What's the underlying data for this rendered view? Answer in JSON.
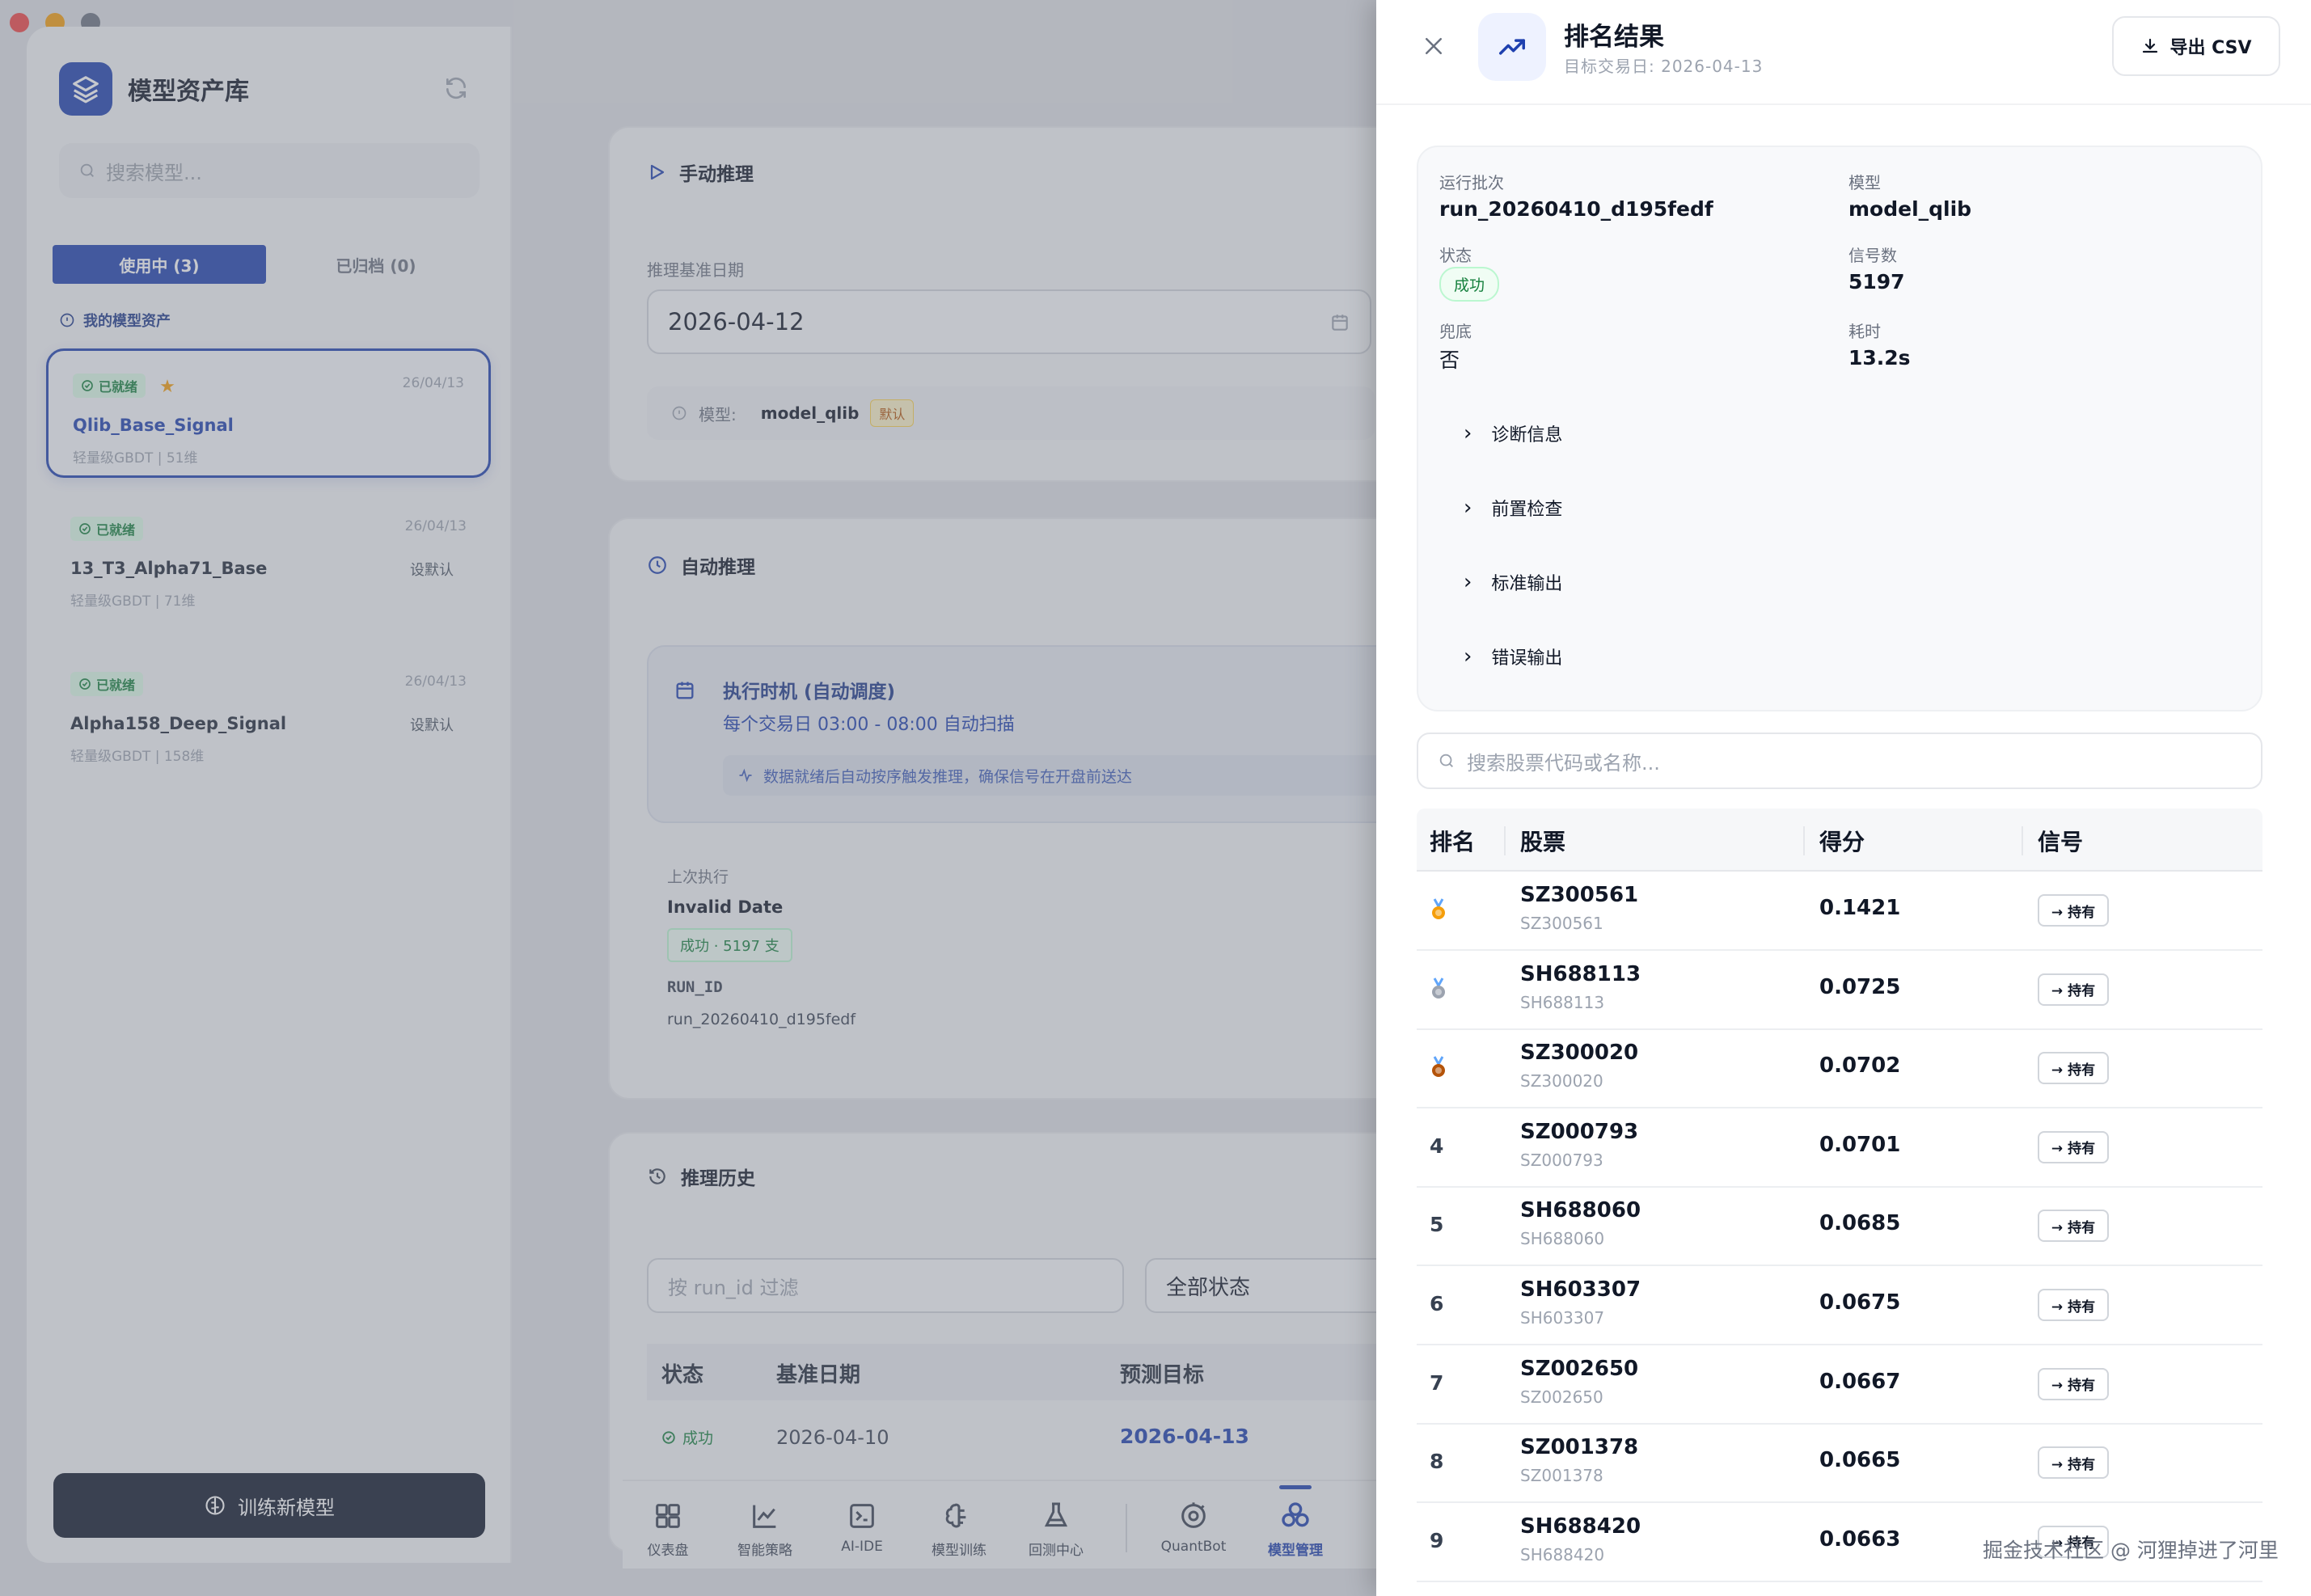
{
  "left": {
    "title": "模型资产库",
    "search_placeholder": "搜索模型...",
    "tab_active": "使用中 (3)",
    "tab_archived": "已归档 (0)",
    "section": "我的模型资产",
    "models": [
      {
        "status": "已就绪",
        "date": "26/04/13",
        "name": "Qlib_Base_Signal",
        "meta": "轻量级GBDT | 51维",
        "starred": true,
        "action": ""
      },
      {
        "status": "已就绪",
        "date": "26/04/13",
        "name": "13_T3_Alpha71_Base",
        "meta": "轻量级GBDT | 71维",
        "starred": false,
        "action": "设默认"
      },
      {
        "status": "已就绪",
        "date": "26/04/13",
        "name": "Alpha158_Deep_Signal",
        "meta": "轻量级GBDT | 158维",
        "starred": false,
        "action": "设默认"
      }
    ],
    "train_button": "训练新模型"
  },
  "middle": {
    "manual_title": "手动推理",
    "base_date_label": "推理基准日期",
    "base_date_value": "2026-04-12",
    "model_label": "模型:",
    "model_value": "model_qlib",
    "default_tag": "默认",
    "auto_title": "自动推理",
    "schedule_title": "执行时机 (自动调度)",
    "schedule_desc": "每个交易日 03:00 - 08:00 自动扫描",
    "schedule_note": "数据就绪后自动按序触发推理，确保信号在开盘前送达",
    "last_exec_label": "上次执行",
    "last_exec_value": "Invalid Date",
    "last_exec_badge": "成功 · 5197 支",
    "run_id_label": "RUN_ID",
    "run_id_value": "run_20260410_d195fedf",
    "history_title": "推理历史",
    "filter_placeholder": "按 run_id 过滤",
    "status_filter": "全部状态",
    "history_headers": [
      "状态",
      "基准日期",
      "预测目标"
    ],
    "history_row": {
      "status": "成功",
      "base_date": "2026-04-10",
      "target": "2026-04-13"
    }
  },
  "nav": [
    "仪表盘",
    "智能策略",
    "AI-IDE",
    "模型训练",
    "回测中心",
    "QuantBot",
    "模型管理"
  ],
  "drawer": {
    "title": "排名结果",
    "subtitle": "目标交易日: 2026-04-13",
    "export_label": "导出 CSV",
    "info": {
      "run_batch_label": "运行批次",
      "run_batch_value": "run_20260410_d195fedf",
      "model_label": "模型",
      "model_value": "model_qlib",
      "status_label": "状态",
      "status_value": "成功",
      "signals_label": "信号数",
      "signals_value": "5197",
      "fallback_label": "兜底",
      "fallback_value": "否",
      "elapsed_label": "耗时",
      "elapsed_value": "13.2s"
    },
    "sections": [
      "诊断信息",
      "前置检查",
      "标准输出",
      "错误输出"
    ],
    "search_placeholder": "搜索股票代码或名称...",
    "headers": [
      "排名",
      "股票",
      "得分",
      "信号"
    ],
    "rows": [
      {
        "rank": "",
        "medal": "gold",
        "code": "SZ300561",
        "sub": "SZ300561",
        "score": "0.1421",
        "signal": "→ 持有"
      },
      {
        "rank": "",
        "medal": "silver",
        "code": "SH688113",
        "sub": "SH688113",
        "score": "0.0725",
        "signal": "→ 持有"
      },
      {
        "rank": "",
        "medal": "bronze",
        "code": "SZ300020",
        "sub": "SZ300020",
        "score": "0.0702",
        "signal": "→ 持有"
      },
      {
        "rank": "4",
        "medal": "",
        "code": "SZ000793",
        "sub": "SZ000793",
        "score": "0.0701",
        "signal": "→ 持有"
      },
      {
        "rank": "5",
        "medal": "",
        "code": "SH688060",
        "sub": "SH688060",
        "score": "0.0685",
        "signal": "→ 持有"
      },
      {
        "rank": "6",
        "medal": "",
        "code": "SH603307",
        "sub": "SH603307",
        "score": "0.0675",
        "signal": "→ 持有"
      },
      {
        "rank": "7",
        "medal": "",
        "code": "SZ002650",
        "sub": "SZ002650",
        "score": "0.0667",
        "signal": "→ 持有"
      },
      {
        "rank": "8",
        "medal": "",
        "code": "SZ001378",
        "sub": "SZ001378",
        "score": "0.0665",
        "signal": "→ 持有"
      },
      {
        "rank": "9",
        "medal": "",
        "code": "SH688420",
        "sub": "SH688420",
        "score": "0.0663",
        "signal": "→ 持有"
      }
    ]
  },
  "watermark": "掘金技术社区 @ 河狸掉进了河里",
  "colors": {
    "brand": "#1e40af",
    "success": "#15803d",
    "gold": "#f59e0b",
    "silver": "#9ca3af",
    "bronze": "#b45309"
  }
}
